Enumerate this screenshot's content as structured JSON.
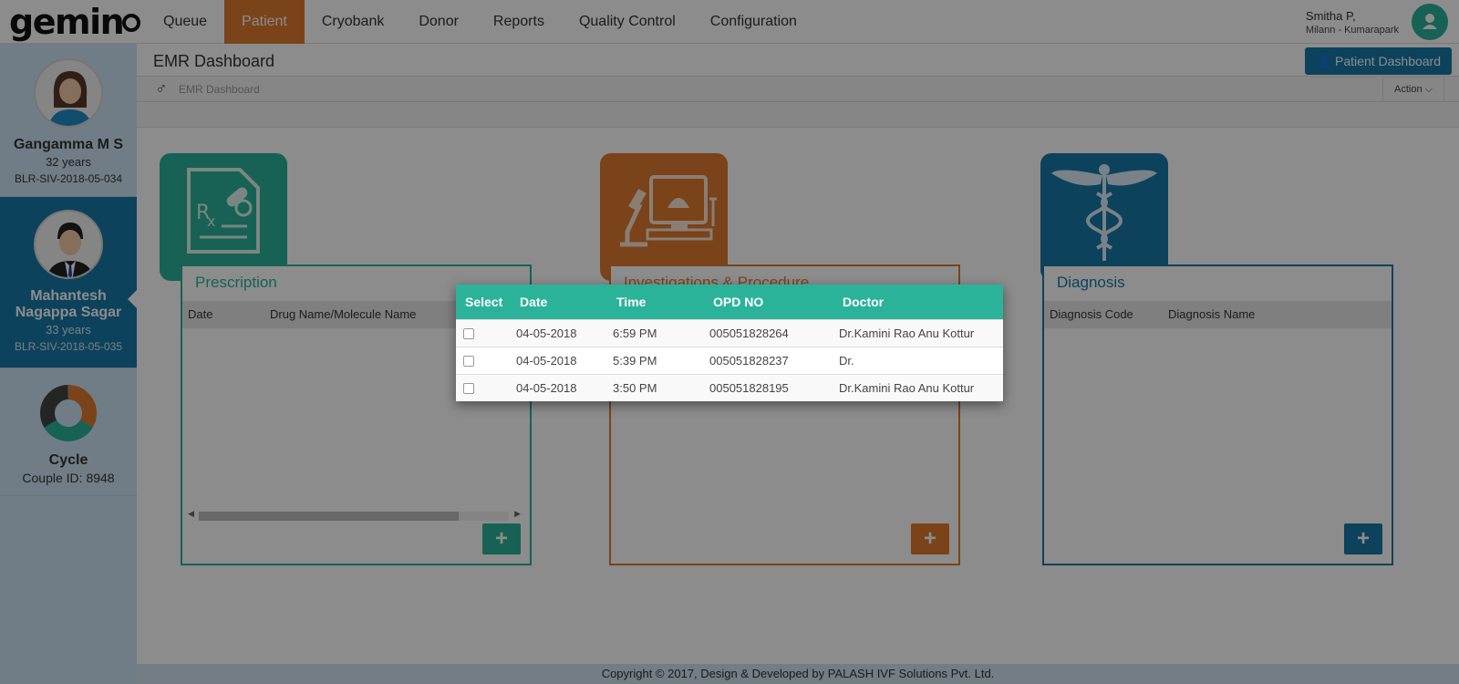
{
  "topbar": {
    "logo": "gemin",
    "nav": [
      "Queue",
      "Patient",
      "Cryobank",
      "Donor",
      "Reports",
      "Quality Control",
      "Configuration"
    ],
    "active_nav": "Patient",
    "user_name": "Smitha P,",
    "user_location": "Milann - Kumarapark"
  },
  "sidebar": {
    "patient1": {
      "name": "Gangamma M S",
      "age": "32 years",
      "id": "BLR-SIV-2018-05-034"
    },
    "patient2": {
      "name_line1": "Mahantesh",
      "name_line2": "Nagappa Sagar",
      "age": "33 years",
      "id": "BLR-SIV-2018-05-035"
    },
    "cycle": {
      "label": "Cycle",
      "couple_id": "Couple ID: 8948"
    }
  },
  "page": {
    "title": "EMR Dashboard",
    "patient_dashboard_button": "Patient Dashboard",
    "breadcrumb": "EMR Dashboard",
    "action_button": "Action"
  },
  "panels": {
    "prescription": {
      "title": "Prescription",
      "columns": [
        "Date",
        "Drug Name/Molecule Name"
      ],
      "color": "#2bb39a"
    },
    "investigations": {
      "title": "Investigations & Procedure",
      "color": "#e07b2e"
    },
    "diagnosis": {
      "title": "Diagnosis",
      "columns": [
        "Diagnosis Code",
        "Diagnosis Name"
      ],
      "color": "#1878a8"
    }
  },
  "popup": {
    "headers": [
      "Select",
      "Date",
      "Time",
      "OPD NO",
      "Doctor"
    ],
    "rows": [
      {
        "date": "04-05-2018",
        "time": "6:59 PM",
        "opd": "005051828264",
        "doctor": "Dr.Kamini Rao Anu Kottur"
      },
      {
        "date": "04-05-2018",
        "time": "5:39 PM",
        "opd": "005051828237",
        "doctor": "Dr."
      },
      {
        "date": "04-05-2018",
        "time": "3:50 PM",
        "opd": "005051828195",
        "doctor": "Dr.Kamini Rao Anu Kottur"
      }
    ]
  },
  "footer": "Copyright © 2017, Design & Developed by PALASH IVF Solutions Pvt. Ltd."
}
